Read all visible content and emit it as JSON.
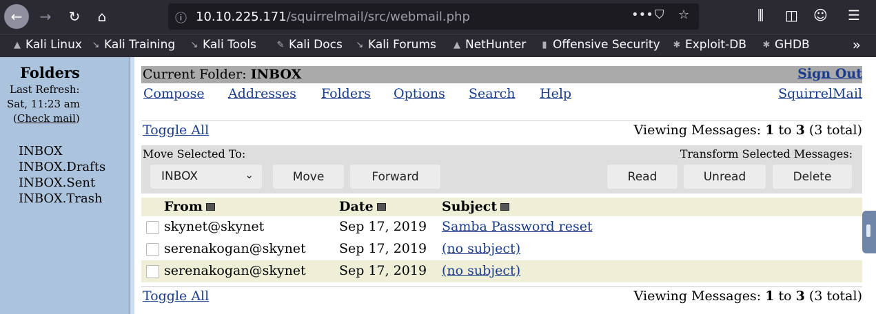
{
  "browser": {
    "url_host": "10.10.225.171",
    "url_path": "/squirrelmail/src/webmail.php",
    "bookmarks": [
      {
        "label": "Kali Linux",
        "icon": "kali-dragon-icon"
      },
      {
        "label": "Kali Training",
        "icon": "kali-dragon-icon"
      },
      {
        "label": "Kali Tools",
        "icon": "kali-dragon-icon"
      },
      {
        "label": "Kali Docs",
        "icon": "kali-docs-icon"
      },
      {
        "label": "Kali Forums",
        "icon": "kali-dragon-icon"
      },
      {
        "label": "NetHunter",
        "icon": "nethunter-icon"
      },
      {
        "label": "Offensive Security",
        "icon": "offsec-icon"
      },
      {
        "label": "Exploit-DB",
        "icon": "exploit-db-icon"
      },
      {
        "label": "GHDB",
        "icon": "ghdb-icon"
      }
    ]
  },
  "left": {
    "title": "Folders",
    "last_refresh_label": "Last Refresh:",
    "last_refresh_value": "Sat, 11:23 am",
    "check_mail": "Check mail",
    "folders": [
      "INBOX",
      "INBOX.Drafts",
      "INBOX.Sent",
      "INBOX.Trash"
    ]
  },
  "header": {
    "current_folder_label": "Current Folder:",
    "current_folder": "INBOX",
    "sign_out": "Sign Out",
    "menu": [
      "Compose",
      "Addresses",
      "Folders",
      "Options",
      "Search",
      "Help"
    ],
    "brand": "SquirrelMail"
  },
  "listing": {
    "toggle_all": "Toggle All",
    "viewing_prefix": "Viewing Messages:",
    "from": "1",
    "to_word": "to",
    "to": "3",
    "total": "(3 total)"
  },
  "actions": {
    "move_selected_label": "Move Selected To:",
    "folder_select": "INBOX",
    "move": "Move",
    "forward": "Forward",
    "transform_label": "Transform Selected Messages:",
    "read": "Read",
    "unread": "Unread",
    "delete": "Delete"
  },
  "table": {
    "columns": [
      "From",
      "Date",
      "Subject"
    ],
    "rows": [
      {
        "from": "skynet@skynet",
        "date": "Sep 17, 2019",
        "subject": "Samba Password reset"
      },
      {
        "from": "serenakogan@skynet",
        "date": "Sep 17, 2019",
        "subject": "(no subject)"
      },
      {
        "from": "serenakogan@skynet",
        "date": "Sep 17, 2019",
        "subject": "(no subject)"
      }
    ]
  },
  "colors": {
    "left_pane": "#abc3dd",
    "header_bar": "#aaaaaa",
    "row_alt": "#efefd8",
    "link": "#1a3c8c"
  }
}
